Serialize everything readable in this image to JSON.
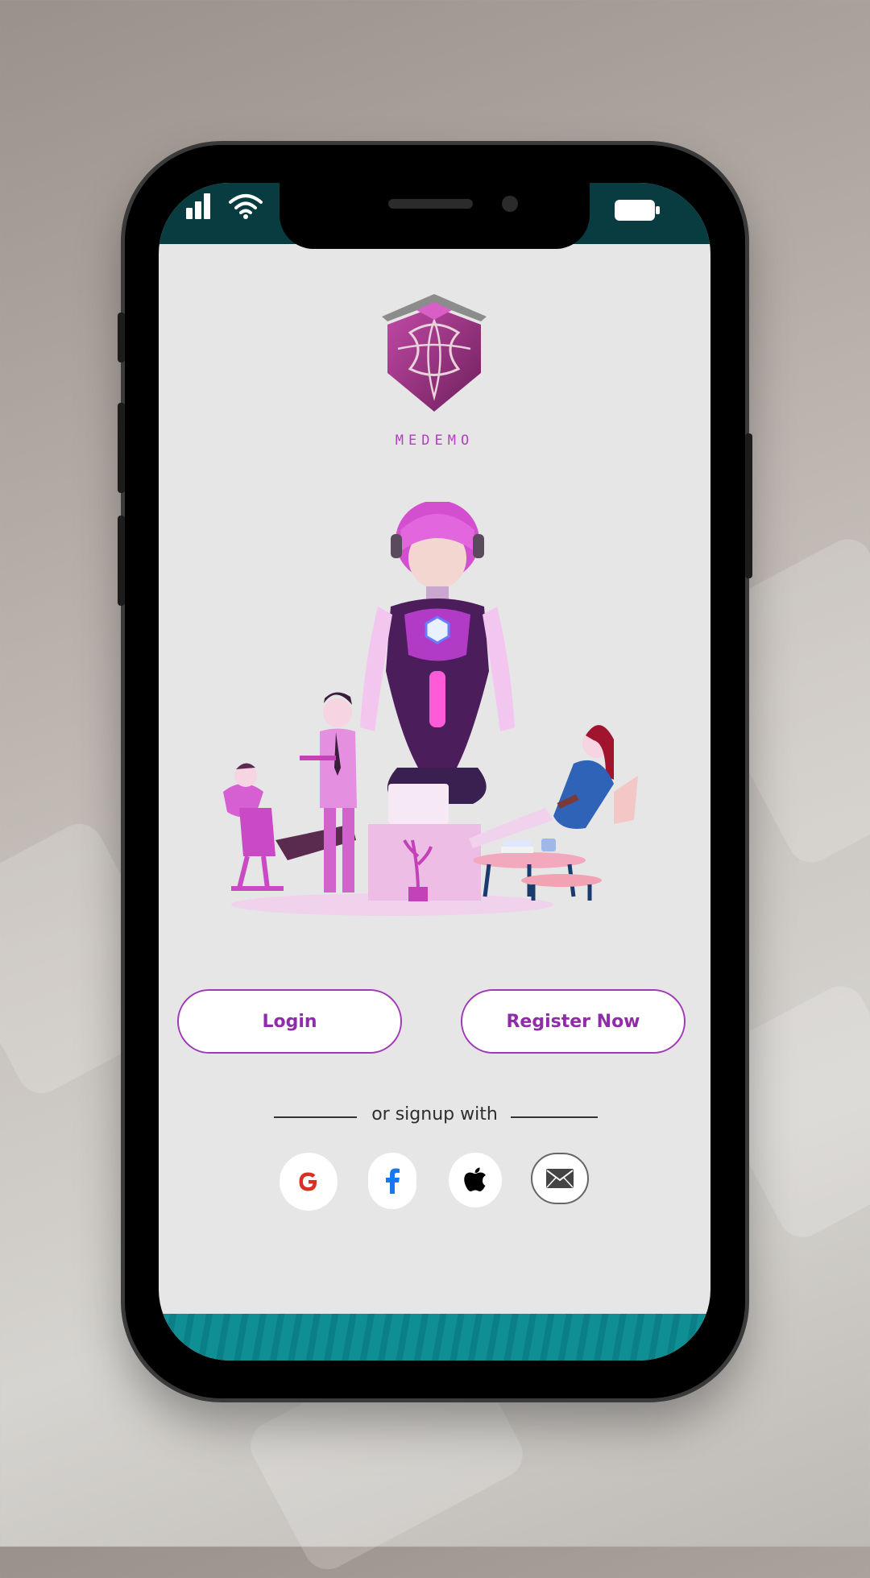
{
  "app": {
    "brand_name": "MEDEMO"
  },
  "actions": {
    "login_label": "Login",
    "register_label": "Register Now"
  },
  "signup": {
    "divider_text": "or signup with",
    "providers": [
      {
        "name": "Google",
        "icon": "google-icon",
        "glyph": "G",
        "color": "#d93025"
      },
      {
        "name": "Facebook",
        "icon": "facebook-icon",
        "glyph": "f",
        "color": "#1877f2"
      },
      {
        "name": "Apple",
        "icon": "apple-icon",
        "color": "#000000"
      },
      {
        "name": "Email",
        "icon": "mail-icon",
        "color": "#444444"
      }
    ]
  },
  "colors": {
    "accent": "#a03bb8",
    "status_bar": "#083c40",
    "bottom_bar": "#0f8e94",
    "screen_bg": "#e6e6e6"
  }
}
